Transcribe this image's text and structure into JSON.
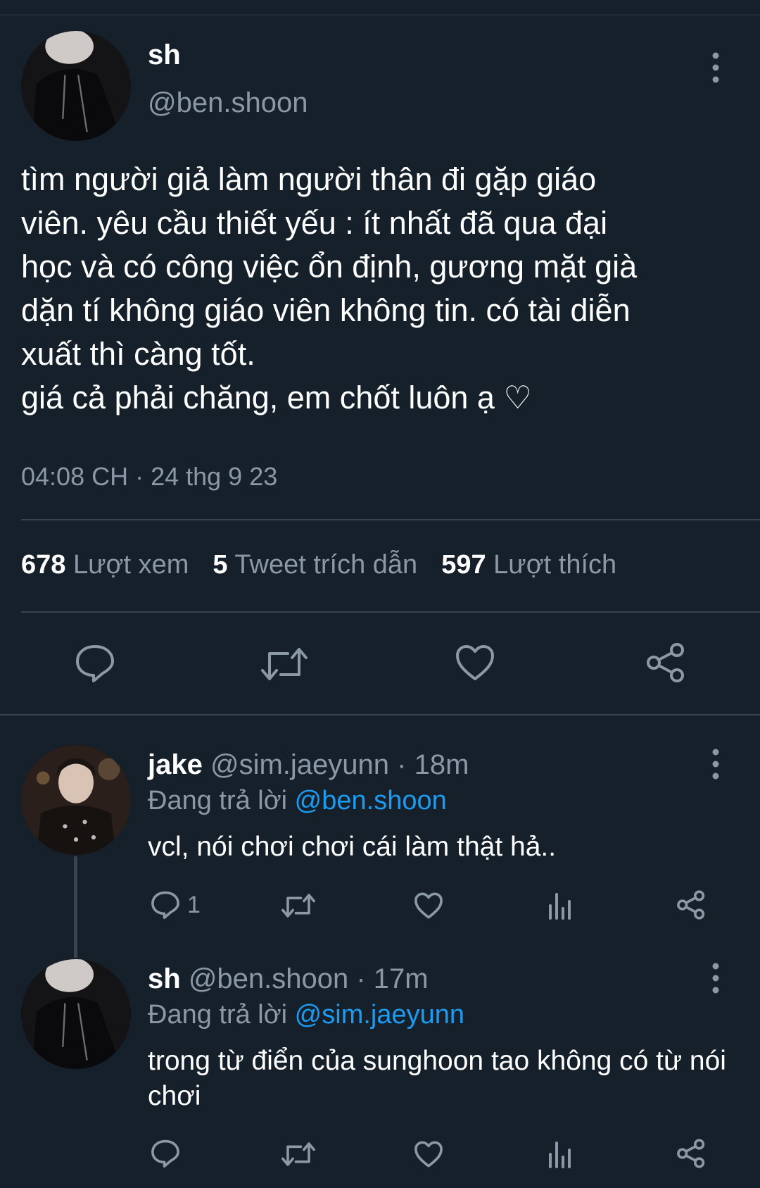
{
  "main_tweet": {
    "display_name": "sh",
    "handle": "@ben.shoon",
    "text": "tìm người giả làm người thân đi gặp giáo\nviên. yêu cầu thiết yếu : ít nhất đã qua đại\nhọc và có công việc ổn định, gương mặt già\ndặn tí không giáo viên không tin. có tài diễn\nxuất thì càng tốt.\ngiá cả phải chăng, em chốt luôn ạ ♡",
    "timestamp": "04:08 CH · 24 thg 9 23",
    "stats": {
      "views_count": "678",
      "views_label": "Lượt xem",
      "quotes_count": "5",
      "quotes_label": "Tweet trích dẫn",
      "likes_count": "597",
      "likes_label": "Lượt thích"
    },
    "actions": [
      "reply-icon",
      "retweet-icon",
      "like-icon",
      "share-icon"
    ]
  },
  "replies": [
    {
      "display_name": "jake",
      "handle_time": "@sim.jaeyunn · 18m",
      "replying_label": "Đang trả lời",
      "replying_to": "@ben.shoon",
      "text": "vcl, nói chơi chơi cái làm thật hả..",
      "reply_count": "1"
    },
    {
      "display_name": "sh",
      "handle_time": "@ben.shoon · 17m",
      "replying_label": "Đang trả lời",
      "replying_to": "@sim.jaeyunn",
      "text": "trong từ điển của sunghoon tao không có từ nói chơi",
      "reply_count": ""
    }
  ],
  "colors": {
    "background": "#15202b",
    "muted": "#8b98a5",
    "link": "#1d9bf0",
    "divider": "#38444d"
  }
}
